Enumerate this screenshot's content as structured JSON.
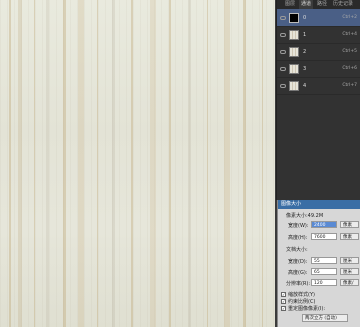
{
  "layers_panel": {
    "tabs": [
      "图层",
      "通道",
      "路径",
      "历史记录"
    ],
    "active_tab": 1,
    "rows": [
      {
        "name": "0",
        "shortcut": "Ctrl+2",
        "thumb": "black",
        "selected": true
      },
      {
        "name": "1",
        "shortcut": "Ctrl+4",
        "thumb": "wood",
        "selected": false
      },
      {
        "name": "2",
        "shortcut": "Ctrl+5",
        "thumb": "wood",
        "selected": false
      },
      {
        "name": "3",
        "shortcut": "Ctrl+6",
        "thumb": "wood",
        "selected": false
      },
      {
        "name": "4",
        "shortcut": "Ctrl+7",
        "thumb": "wood",
        "selected": false
      }
    ]
  },
  "image_size_dialog": {
    "title": "图像大小",
    "pixel_dims_label": "像素大小:49.2M",
    "width_label": "宽度(W):",
    "width_value": "2400",
    "width_unit": "像素",
    "height_label": "高度(H):",
    "height_value": "7600",
    "height_unit": "像素",
    "doc_size_label": "文档大小:",
    "doc_width_label": "宽度(D):",
    "doc_width_value": "55",
    "doc_width_unit": "厘米",
    "doc_height_label": "高度(G):",
    "doc_height_value": "65",
    "doc_height_unit": "厘米",
    "resolution_label": "分辨率(R):",
    "resolution_value": "120",
    "resolution_unit": "像素/英寸",
    "scale_styles": "缩放样式(Y)",
    "constrain": "约束比例(C)",
    "resample": "重定图像像素(I):",
    "resample_method": "两次立方 (自动)"
  }
}
